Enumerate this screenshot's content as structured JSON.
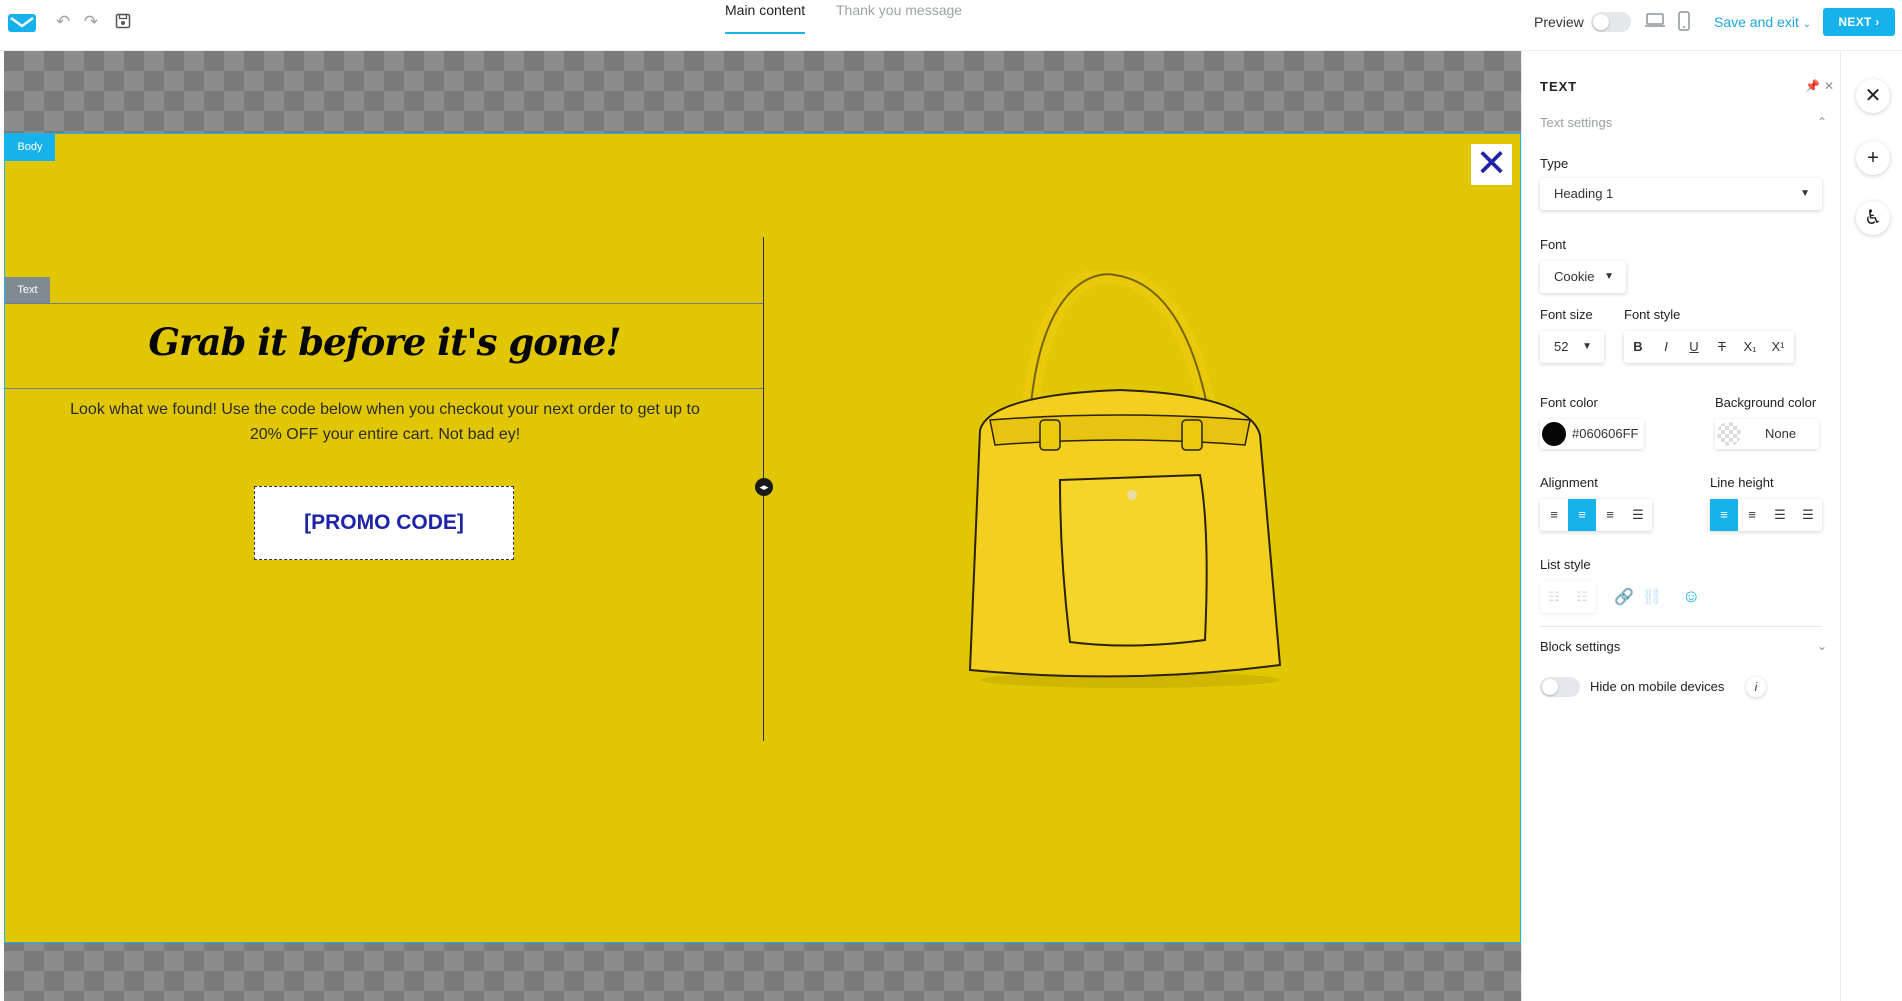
{
  "header": {
    "tabs": [
      {
        "label": "Main content",
        "active": true
      },
      {
        "label": "Thank you message",
        "active": false
      }
    ],
    "preview_label": "Preview",
    "save_exit_label": "Save and exit",
    "next_label": "NEXT",
    "icons": [
      "logo-icon",
      "undo-icon",
      "redo-icon",
      "save-icon",
      "desktop-icon",
      "mobile-icon"
    ],
    "accent_color": "#16b2ec"
  },
  "canvas": {
    "body_tag": "Body",
    "text_tag": "Text",
    "heading": "Grab it before it's gone!",
    "body_text": "Look what we found! Use the code below when you checkout your next order to get up to 20% OFF your entire cart. Not bad ey!",
    "promo_label": "[PROMO CODE]",
    "background_color": "#e1c703",
    "close_symbol": "✕"
  },
  "panel": {
    "title": "TEXT",
    "section": "Text settings",
    "type_label": "Type",
    "type_value": "Heading 1",
    "font_label": "Font",
    "font_value": "Cookie",
    "font_size_label": "Font size",
    "font_size_value": "52",
    "font_style_label": "Font style",
    "font_style_buttons": [
      "B",
      "I",
      "U",
      "T",
      "X₁",
      "X¹"
    ],
    "font_color_label": "Font color",
    "font_color_value": "#060606FF",
    "bg_color_label": "Background color",
    "bg_color_value": "None",
    "alignment_label": "Alignment",
    "line_height_label": "Line height",
    "list_style_label": "List style",
    "block_settings_label": "Block settings",
    "hide_mobile_label": "Hide on mobile devices",
    "info_symbol": "i"
  },
  "rail": {
    "buttons": [
      "close-icon",
      "add-icon",
      "accessibility-icon"
    ]
  }
}
